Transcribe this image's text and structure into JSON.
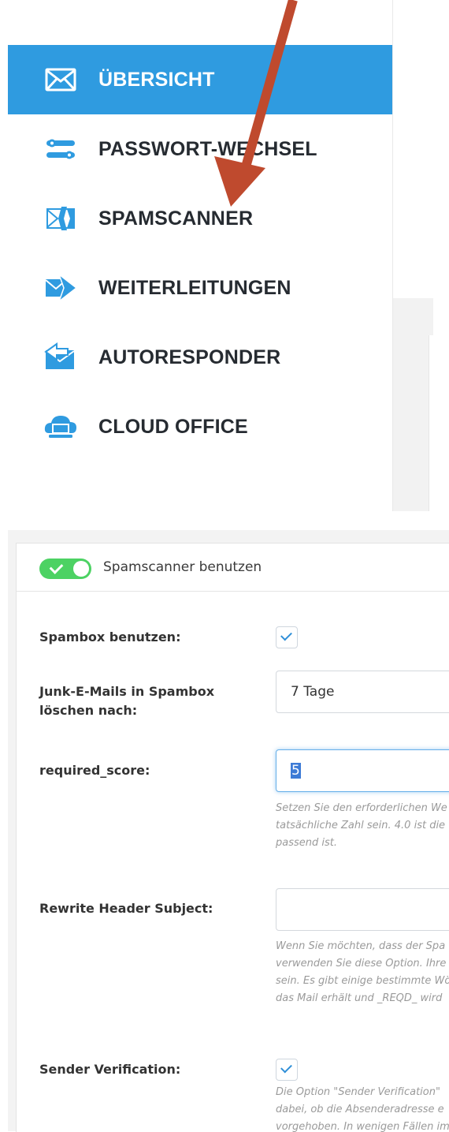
{
  "colors": {
    "nav_active_bg": "#2f9be0",
    "nav_icon": "#2f9be0",
    "arrow": "#bf4a2e",
    "toggle_on": "#4cd263",
    "check": "#2f8fd8",
    "help_text": "#9a9a9a"
  },
  "nav": {
    "items": [
      {
        "label": "ÜBERSICHT",
        "icon": "envelope-icon",
        "active": true
      },
      {
        "label": "PASSWORT-WECHSEL",
        "icon": "key-icon",
        "active": false
      },
      {
        "label": "SPAMSCANNER",
        "icon": "spam-envelope-icon",
        "active": false
      },
      {
        "label": "WEITERLEITUNGEN",
        "icon": "forward-envelope-icon",
        "active": false
      },
      {
        "label": "AUTORESPONDER",
        "icon": "reply-envelope-icon",
        "active": false
      },
      {
        "label": "CLOUD OFFICE",
        "icon": "cloud-laptop-icon",
        "active": false
      }
    ]
  },
  "spamscanner": {
    "toggle_label": "Spamscanner benutzen",
    "toggle_on": true,
    "spambox": {
      "label": "Spambox benutzen:",
      "checked": true
    },
    "junk_delete": {
      "label_line1": "Junk-E-Mails in Spambox",
      "label_line2": "löschen nach:",
      "value": "7 Tage"
    },
    "required_score": {
      "label": "required_score:",
      "value": "5",
      "help": [
        "Setzen Sie den erforderlichen We",
        "tatsächliche Zahl sein. 4.0 ist die",
        "passend ist."
      ]
    },
    "rewrite_subject": {
      "label": "Rewrite Header Subject:",
      "value": "",
      "help": [
        "Wenn Sie möchten, dass der Spa",
        "verwenden Sie diese Option. Ihre",
        "sein. Es gibt einige bestimmte Wö",
        "das Mail erhält und _REQD_ wird"
      ]
    },
    "sender_verification": {
      "label": "Sender Verification:",
      "checked": true,
      "help": [
        "Die Option \"Sender Verification\"",
        "dabei, ob die Absenderadresse e",
        "vorgehoben. In wenigen Fällen im"
      ]
    }
  }
}
